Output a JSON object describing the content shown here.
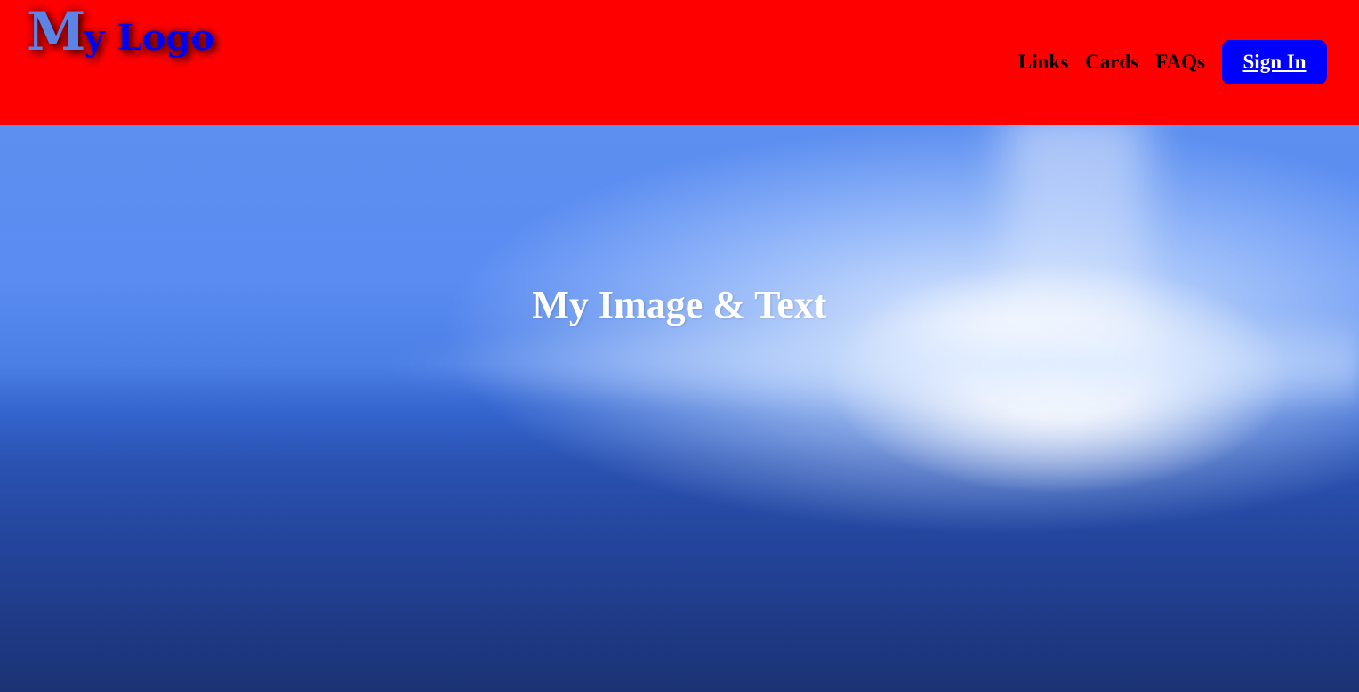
{
  "header": {
    "logo": {
      "first_letter": "M",
      "rest": "y Logo"
    },
    "nav": [
      {
        "label": "Links"
      },
      {
        "label": "Cards"
      },
      {
        "label": "FAQs"
      }
    ],
    "sign_in_label": "Sign In"
  },
  "hero": {
    "title": "My Image & Text"
  },
  "colors": {
    "header_bg": "#ff0000",
    "sign_in_bg": "#0000ff",
    "logo_primary": "#0000ee",
    "logo_first_letter": "#5b84e6",
    "hero_text": "#ffffff"
  }
}
